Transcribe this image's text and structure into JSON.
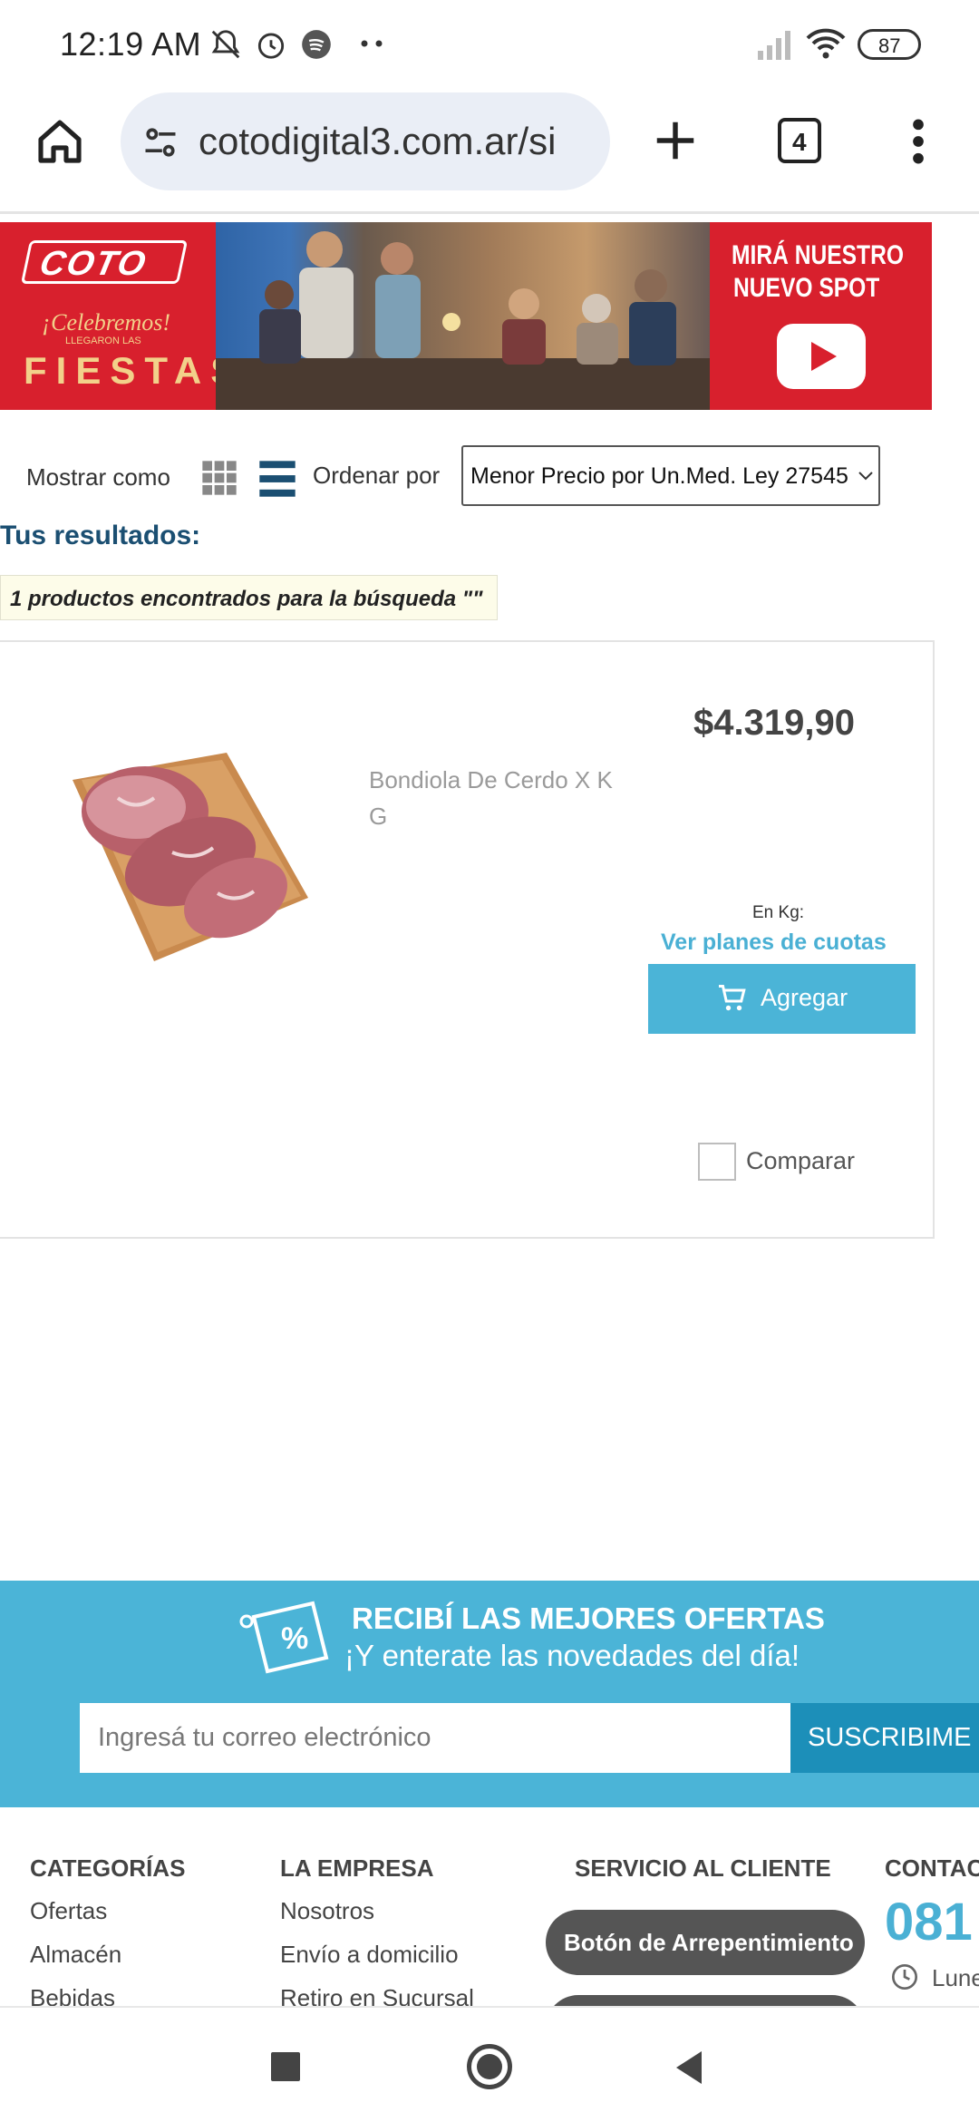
{
  "status_bar": {
    "time": "12:19 AM",
    "battery": "87",
    "icons": [
      "mute-bell-icon",
      "alarm-icon",
      "spotify-icon",
      "more-dots-icon",
      "signal-icon",
      "wifi-icon",
      "battery-icon"
    ]
  },
  "browser": {
    "url": "cotodigital3.com.ar/si",
    "tab_count": "4"
  },
  "banner": {
    "brand": "COTO",
    "tagline_1": "¡Celebremos!",
    "tagline_2": "LLEGARON LAS",
    "tagline_3": "FIESTAS",
    "cta_1": "MIRÁ NUESTRO",
    "cta_2": "NUEVO SPOT"
  },
  "controls": {
    "show_as": "Mostrar como",
    "sort_by": "Ordenar por",
    "sort_selected": "Menor Precio por Un.Med. Ley 27545"
  },
  "results": {
    "title": "Tus resultados:",
    "found_text": "1 productos encontrados para la búsqueda \"\""
  },
  "product": {
    "price": "$4.319,90",
    "name": "Bondiola De Cerdo X K G",
    "unit": "En Kg:",
    "installments_link": "Ver planes de cuotas",
    "add_label": "Agregar",
    "compare_label": "Comparar"
  },
  "newsletter": {
    "headline": "RECIBÍ LAS MEJORES OFERTAS",
    "subline": "¡Y enterate las novedades del día!",
    "email_placeholder": "Ingresá tu correo electrónico",
    "subscribe_label": "SUSCRIBIME"
  },
  "footer": {
    "categories_title": "CATEGORÍAS",
    "categories": [
      "Ofertas",
      "Almacén",
      "Bebidas"
    ],
    "company_title": "LA EMPRESA",
    "company": [
      "Nosotros",
      "Envío a domicilio",
      "Retiro en Sucursal"
    ],
    "service_title": "SERVICIO AL CLIENTE",
    "regret_button": "Botón de Arrepentimiento",
    "contact_title": "CONTAC",
    "phone_partial": "081",
    "hours_partial": "Lune"
  },
  "colors": {
    "accent": "#4bb4d7",
    "brand_red": "#d8202d",
    "heading_blue": "#1b4f72"
  }
}
